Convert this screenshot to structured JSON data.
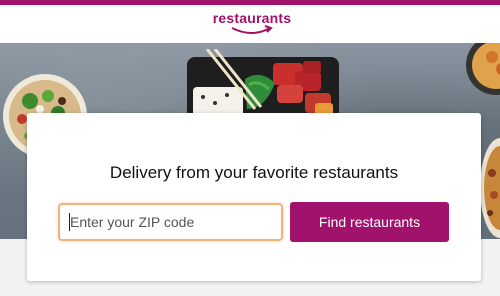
{
  "header": {
    "logo_text": "restaurants",
    "brand_color": "#a0126b"
  },
  "hero": {
    "headline": "Delivery from your favorite restaurants"
  },
  "search": {
    "placeholder": "Enter your ZIP code",
    "value": "",
    "button_label": "Find restaurants"
  },
  "colors": {
    "accent": "#a0126b",
    "input_focus_border": "#f0b27a"
  },
  "images": [
    "tacos-plate-image",
    "poke-bowl-image",
    "food-plate-right-image"
  ]
}
